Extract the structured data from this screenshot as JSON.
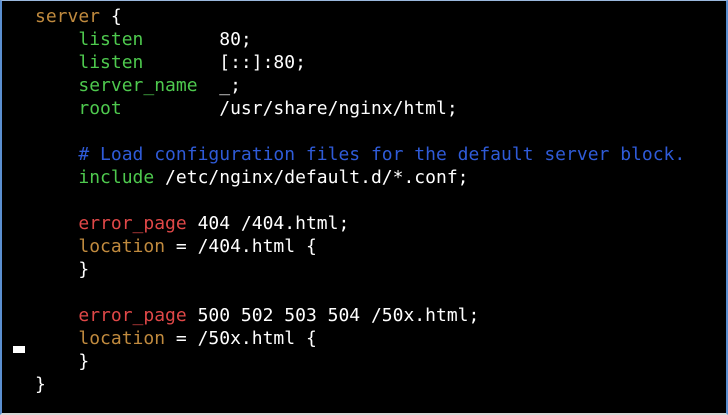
{
  "colors": {
    "background": "#000000",
    "plain": "#ffffff",
    "keyword": "#c08a3e",
    "directive": "#4ec94e",
    "comment": "#2f5bd8",
    "error": "#e04848"
  },
  "lines": [
    [
      {
        "t": "server",
        "c": "keyword"
      },
      {
        "t": " {",
        "c": "plain"
      }
    ],
    [
      {
        "t": "    ",
        "c": "plain"
      },
      {
        "t": "listen",
        "c": "directive"
      },
      {
        "t": "       80;",
        "c": "plain"
      }
    ],
    [
      {
        "t": "    ",
        "c": "plain"
      },
      {
        "t": "listen",
        "c": "directive"
      },
      {
        "t": "       [::]:80;",
        "c": "plain"
      }
    ],
    [
      {
        "t": "    ",
        "c": "plain"
      },
      {
        "t": "server_name",
        "c": "directive"
      },
      {
        "t": "  _;",
        "c": "plain"
      }
    ],
    [
      {
        "t": "    ",
        "c": "plain"
      },
      {
        "t": "root",
        "c": "directive"
      },
      {
        "t": "         /usr/share/nginx/html;",
        "c": "plain"
      }
    ],
    [],
    [
      {
        "t": "    ",
        "c": "plain"
      },
      {
        "t": "# Load configuration files for the default server block.",
        "c": "comment"
      }
    ],
    [
      {
        "t": "    ",
        "c": "plain"
      },
      {
        "t": "include",
        "c": "directive"
      },
      {
        "t": " /etc/nginx/default.d/*.conf;",
        "c": "plain"
      }
    ],
    [],
    [
      {
        "t": "    ",
        "c": "plain"
      },
      {
        "t": "error_page",
        "c": "error"
      },
      {
        "t": " 404 /404.html;",
        "c": "plain"
      }
    ],
    [
      {
        "t": "    ",
        "c": "plain"
      },
      {
        "t": "location",
        "c": "keyword"
      },
      {
        "t": " = /404.html {",
        "c": "plain"
      }
    ],
    [
      {
        "t": "    }",
        "c": "plain"
      }
    ],
    [],
    [
      {
        "t": "    ",
        "c": "plain"
      },
      {
        "t": "error_page",
        "c": "error"
      },
      {
        "t": " 500 502 503 504 /50x.html;",
        "c": "plain"
      }
    ],
    [
      {
        "t": "    ",
        "c": "plain"
      },
      {
        "t": "location",
        "c": "keyword"
      },
      {
        "t": " = /50x.html {",
        "c": "plain"
      }
    ],
    [
      {
        "t": "    }",
        "c": "plain"
      }
    ],
    [
      {
        "t": "}",
        "c": "plain"
      }
    ]
  ]
}
